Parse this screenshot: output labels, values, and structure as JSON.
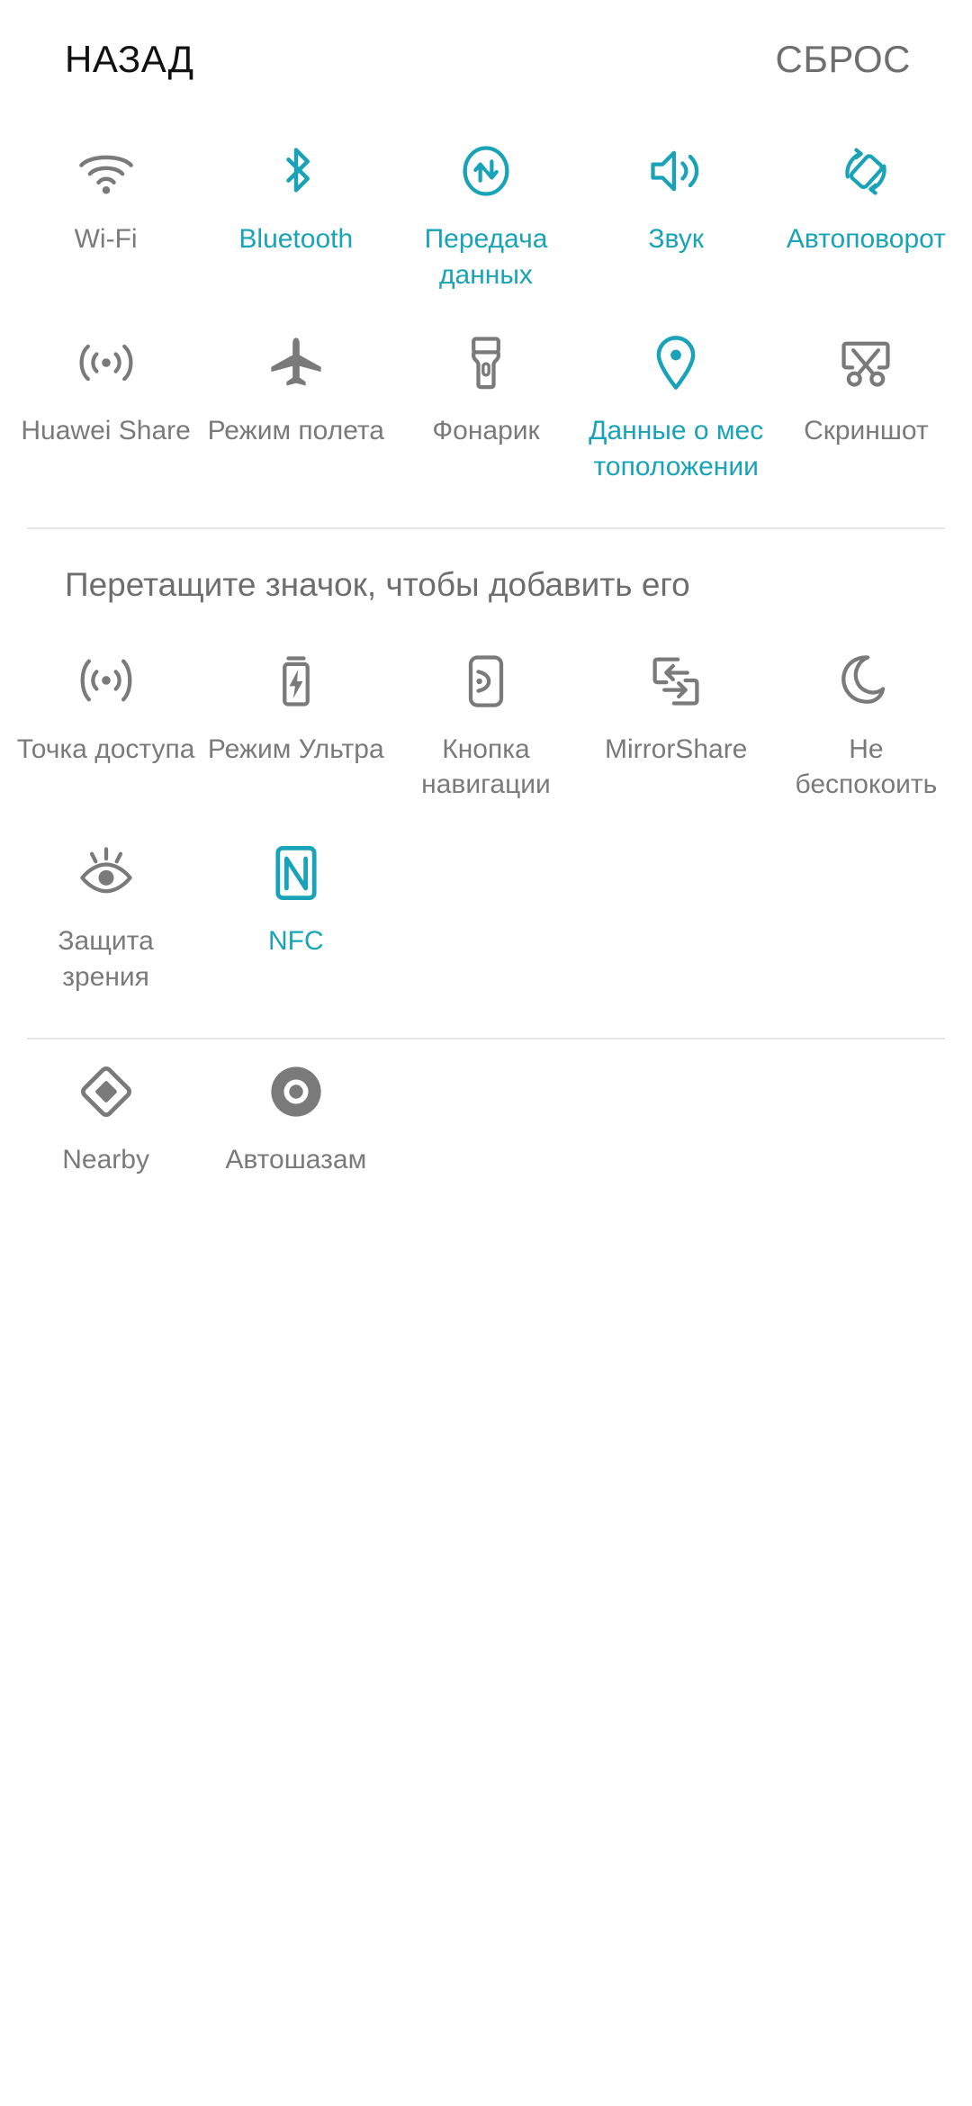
{
  "header": {
    "back_label": "НАЗАД",
    "reset_label": "СБРОС"
  },
  "colors": {
    "accent_on": "#19a3b8",
    "inactive": "#7a7a7a",
    "background": "#ffffff",
    "divider": "#e6e6e6",
    "back_text": "#111111"
  },
  "active_section": {
    "tiles": [
      {
        "label": "Wi-Fi",
        "icon": "wifi-icon",
        "state": "off"
      },
      {
        "label": "Bluetooth",
        "icon": "bluetooth-icon",
        "state": "on"
      },
      {
        "label": "Передача данных",
        "icon": "data-transfer-icon",
        "state": "on"
      },
      {
        "label": "Звук",
        "icon": "sound-icon",
        "state": "on"
      },
      {
        "label": "Автоповорот",
        "icon": "auto-rotate-icon",
        "state": "on"
      },
      {
        "label": "Huawei Share",
        "icon": "huawei-share-icon",
        "state": "off"
      },
      {
        "label": "Режим полета",
        "icon": "airplane-icon",
        "state": "off"
      },
      {
        "label": "Фонарик",
        "icon": "flashlight-icon",
        "state": "off"
      },
      {
        "label": "Данные о мес тоположении",
        "icon": "location-pin-icon",
        "state": "on"
      },
      {
        "label": "Скриншот",
        "icon": "screenshot-scissors-icon",
        "state": "off"
      }
    ]
  },
  "drag_section": {
    "title": "Перетащите значок, чтобы добавить его",
    "tiles": [
      {
        "label": "Точка доступа",
        "icon": "hotspot-icon",
        "state": "off"
      },
      {
        "label": "Режим Ультра",
        "icon": "ultra-battery-icon",
        "state": "off"
      },
      {
        "label": "Кнопка навигации",
        "icon": "nav-button-icon",
        "state": "off"
      },
      {
        "label": "MirrorShare",
        "icon": "mirror-share-icon",
        "state": "off"
      },
      {
        "label": "Не беспокоить",
        "icon": "do-not-disturb-moon-icon",
        "state": "off"
      },
      {
        "label": "Защита зрения",
        "icon": "eye-comfort-icon",
        "state": "off"
      },
      {
        "label": "NFC",
        "icon": "nfc-icon",
        "state": "on"
      }
    ]
  },
  "apps_section": {
    "tiles": [
      {
        "label": "Nearby",
        "icon": "nearby-diamond-icon",
        "state": "off"
      },
      {
        "label": "Автошазам",
        "icon": "shazam-icon",
        "state": "off"
      }
    ]
  }
}
